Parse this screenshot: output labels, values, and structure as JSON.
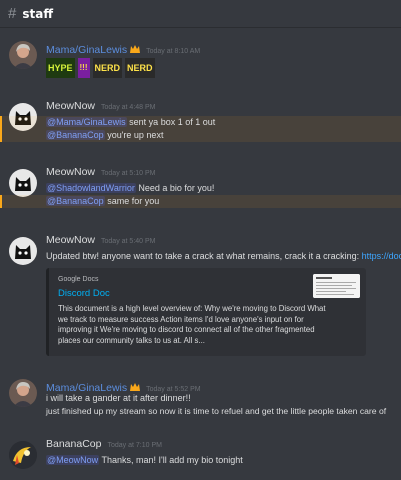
{
  "channel": {
    "hash_icon": "#",
    "name": "staff"
  },
  "colors": {
    "background": "#36393f",
    "author_blue": "#5c8ede",
    "mention": "#7f9ff5",
    "link": "#3ea6ff",
    "highlight_bar": "#faa81a"
  },
  "messages": [
    {
      "author": "Mama/GinaLewis",
      "timestamp": "Today at 8:10 AM",
      "emojis": [
        "HYPE",
        "!!!",
        "NERD",
        "NERD"
      ]
    },
    {
      "author": "MeowNow",
      "timestamp": "Today at 4:48 PM",
      "line1_mention": "@Mama/GinaLewis",
      "line1_text": " sent ya box 1 of 1 out",
      "line2_mention": "@BananaCop",
      "line2_text": " you're up next"
    },
    {
      "author": "MeowNow",
      "timestamp": "Today at 5:10 PM",
      "line1_mention": "@ShadowlandWarrior",
      "line1_text": " Need a bio for you!",
      "line2_mention": "@BananaCop",
      "line2_text": " same for you"
    },
    {
      "author": "MeowNow",
      "timestamp": "Today at 5:40 PM",
      "text": "Updated btw!  anyone want to take a crack at what remains, crack it a cracking: ",
      "link": "https://docs",
      "embed": {
        "provider": "Google Docs",
        "title": "Discord Doc",
        "description": "This document is a high level overview of: Why we're moving to Discord What we track to measure success Action items I'd love anyone's input on for improving it We're moving to discord to connect all of the other fragmented places our community talks to us at. All s..."
      }
    },
    {
      "author": "Mama/GinaLewis",
      "timestamp": "Today at 5:52 PM",
      "line1": "i will take a gander at it after dinner!!",
      "line2": "just finished up my stream so now it is time to refuel and get the little people taken care of"
    },
    {
      "author": "BananaCop",
      "timestamp": "Today at 7:10 PM",
      "line1_mention": "@MeowNow",
      "line1_text": " Thanks, man! I'll add my bio tonight"
    }
  ]
}
